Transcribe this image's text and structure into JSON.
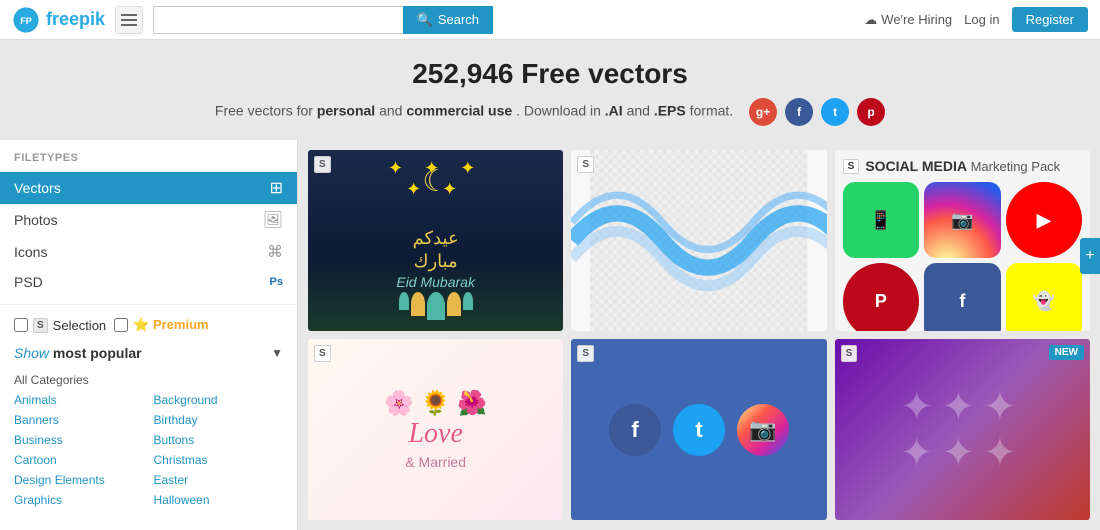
{
  "header": {
    "logo_text": "freepik",
    "search_placeholder": "",
    "search_btn_label": "Search",
    "we_hiring": "We're Hiring",
    "login_label": "Log in",
    "register_label": "Register"
  },
  "hero": {
    "title": "252,946 Free vectors",
    "subtitle_pre": "Free vectors for ",
    "subtitle_bold1": "personal",
    "subtitle_mid": " and ",
    "subtitle_bold2": "commercial use",
    "subtitle_post": ". Download in ",
    "subtitle_ai": ".AI",
    "subtitle_and": " and ",
    "subtitle_eps": ".EPS",
    "subtitle_end": " format."
  },
  "sidebar": {
    "filetypes_label": "FILETYPES",
    "items": [
      {
        "label": "Vectors",
        "icon": "⊞",
        "active": true
      },
      {
        "label": "Photos",
        "icon": "🖼",
        "active": false
      },
      {
        "label": "Icons",
        "icon": "⌘",
        "active": false
      },
      {
        "label": "PSD",
        "icon": "Ps",
        "active": false
      }
    ],
    "selection_label": "Selection",
    "premium_label": "Premium",
    "show_popular_italic": "Show",
    "show_popular_bold": "most popular",
    "categories": {
      "all": "All Categories",
      "left": [
        "Animals",
        "Banners",
        "Business",
        "Cartoon",
        "Design Elements",
        "Graphics"
      ],
      "right": [
        "Background",
        "Birthday",
        "Buttons",
        "Christmas",
        "Easter",
        "Halloween"
      ]
    }
  },
  "content": {
    "cards": [
      {
        "id": "eid",
        "badge": "S",
        "title": "Eid Mubarak"
      },
      {
        "id": "wave",
        "badge": "S"
      },
      {
        "id": "social",
        "badge": "S",
        "title": "SOCIAL MEDIA Marketing Pack"
      },
      {
        "id": "love",
        "badge": "S"
      },
      {
        "id": "fbsocial",
        "badge": "S"
      },
      {
        "id": "purple",
        "badge": "S",
        "new": true
      }
    ]
  },
  "right_handle": "+"
}
